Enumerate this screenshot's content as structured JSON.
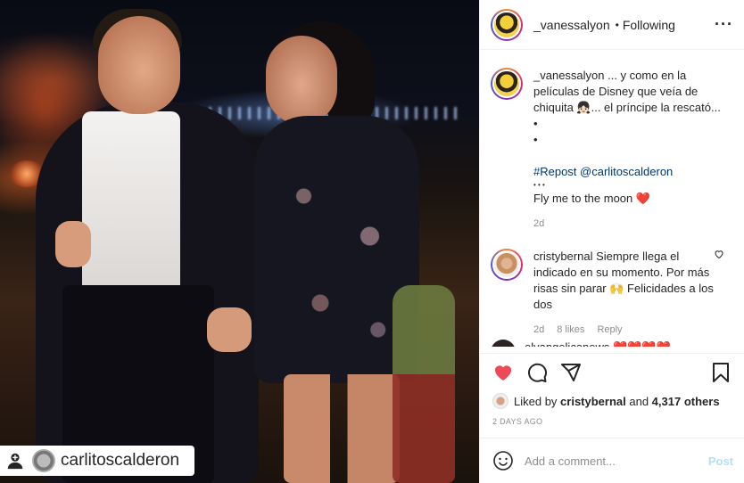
{
  "photo": {
    "tag_user": "carlitoscalderon"
  },
  "header": {
    "username": "_vanessalyon",
    "separator": "•",
    "follow_status": "Following",
    "more": "···"
  },
  "caption": {
    "username": "_vanessalyon",
    "line1": " ... y como en la películas de Disney que veía de chiquita 👧🏻... el príncipe la rescató...",
    "bullet1": "•",
    "bullet2": "•",
    "repost_tag": "#Repost",
    "mention": "@carlitoscalderon",
    "dots": "• • •",
    "closing": "Fly me to the moon ❤️",
    "age": "2d"
  },
  "comment": {
    "username": "cristybernal",
    "text": " Siempre llega el indicado en su momento. Por más risas sin parar 🙌 Felicidades a los dos",
    "age": "2d",
    "likes": "8 likes",
    "reply": "Reply"
  },
  "peek_comment": {
    "username": "elvangelicanews",
    "text": "❤️❤️❤️❤️"
  },
  "actions": {
    "liked_prefix": "Liked by ",
    "liked_user": "cristybernal",
    "liked_and": " and ",
    "liked_count": "4,317 others",
    "date": "2 DAYS AGO"
  },
  "composer": {
    "placeholder": "Add a comment...",
    "post_label": "Post"
  },
  "colors": {
    "like_red": "#ed4956",
    "link_blue": "#00376b",
    "post_disabled": "#b2dffc",
    "muted": "#8e8e8e"
  },
  "icons": [
    "heart-icon",
    "comment-icon",
    "share-icon",
    "bookmark-icon",
    "emoji-icon",
    "more-icon",
    "repost-icon"
  ]
}
